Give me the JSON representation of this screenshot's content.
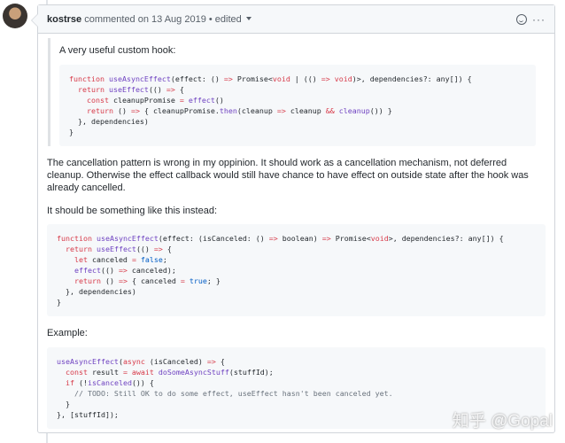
{
  "comment": {
    "author": "kostrse",
    "action": "commented on 13 Aug 2019",
    "edited": "• edited"
  },
  "quote_text": "A very useful custom hook:",
  "code1": [
    [
      [
        "k",
        "function "
      ],
      [
        "f",
        "useAsyncEffect"
      ],
      [
        "",
        "(effect: () "
      ],
      [
        "k",
        "=>"
      ],
      [
        "",
        " Promise<"
      ],
      [
        "k",
        "void"
      ],
      [
        "",
        " | (() "
      ],
      [
        "k",
        "=>"
      ],
      [
        "k",
        " void"
      ],
      [
        "",
        ")>, dependencies?: any[]) {"
      ]
    ],
    [
      [
        "k",
        "  return "
      ],
      [
        "f",
        "useEffect"
      ],
      [
        "",
        "(() "
      ],
      [
        "k",
        "=>"
      ],
      [
        "",
        " {"
      ]
    ],
    [
      [
        "k",
        "    const "
      ],
      [
        "",
        "cleanupPromise "
      ],
      [
        "k",
        "="
      ],
      [
        "f",
        " effect"
      ],
      [
        "",
        "()"
      ]
    ],
    [
      [
        "k",
        "    return "
      ],
      [
        "",
        "() "
      ],
      [
        "k",
        "=>"
      ],
      [
        "",
        " { cleanupPromise."
      ],
      [
        "f",
        "then"
      ],
      [
        "",
        "(cleanup "
      ],
      [
        "k",
        "=>"
      ],
      [
        "",
        " cleanup "
      ],
      [
        "k",
        "&&"
      ],
      [
        "f",
        " cleanup"
      ],
      [
        "",
        "()) }"
      ]
    ],
    [
      [
        "",
        "  }, dependencies)"
      ]
    ],
    [
      [
        "",
        "}"
      ]
    ]
  ],
  "para1": "The cancellation pattern is wrong in my oppinion. It should work as a cancellation mechanism, not deferred cleanup. Otherwise the effect callback would still have chance to have effect on outside state after the hook was already cancelled.",
  "para2": "It should be something like this instead:",
  "code2": [
    [
      [
        "k",
        "function "
      ],
      [
        "f",
        "useAsyncEffect"
      ],
      [
        "",
        "(effect: (isCanceled: () "
      ],
      [
        "k",
        "=>"
      ],
      [
        "",
        " boolean) "
      ],
      [
        "k",
        "=>"
      ],
      [
        "",
        " Promise<"
      ],
      [
        "k",
        "void"
      ],
      [
        "",
        ">, dependencies?: any[]) {"
      ]
    ],
    [
      [
        "k",
        "  return "
      ],
      [
        "f",
        "useEffect"
      ],
      [
        "",
        "(() "
      ],
      [
        "k",
        "=>"
      ],
      [
        "",
        " {"
      ]
    ],
    [
      [
        "k",
        "    let "
      ],
      [
        "",
        "canceled "
      ],
      [
        "k",
        "="
      ],
      [
        "c",
        " false"
      ],
      [
        "",
        ";"
      ]
    ],
    [
      [
        "f",
        "    effect"
      ],
      [
        "",
        "(() "
      ],
      [
        "k",
        "=>"
      ],
      [
        "",
        " canceled);"
      ]
    ],
    [
      [
        "k",
        "    return "
      ],
      [
        "",
        "() "
      ],
      [
        "k",
        "=>"
      ],
      [
        "",
        " { canceled "
      ],
      [
        "k",
        "="
      ],
      [
        "c",
        " true"
      ],
      [
        "",
        "; }"
      ]
    ],
    [
      [
        "",
        "  }, dependencies)"
      ]
    ],
    [
      [
        "",
        "}"
      ]
    ]
  ],
  "para3": "Example:",
  "code3": [
    [
      [
        "f",
        "useAsyncEffect"
      ],
      [
        "",
        "("
      ],
      [
        "k",
        "async"
      ],
      [
        "",
        " (isCanceled) "
      ],
      [
        "k",
        "=>"
      ],
      [
        "",
        " {"
      ]
    ],
    [
      [
        "k",
        "  const "
      ],
      [
        "",
        "result "
      ],
      [
        "k",
        "="
      ],
      [
        "k",
        " await "
      ],
      [
        "f",
        "doSomeAsyncStuff"
      ],
      [
        "",
        "(stuffId);"
      ]
    ],
    [
      [
        "k",
        "  if "
      ],
      [
        "",
        "(!"
      ],
      [
        "f",
        "isCanceled"
      ],
      [
        "",
        "()) {"
      ]
    ],
    [
      [
        "cm",
        "    // TODO: Still OK to do some effect, useEffect hasn't been canceled yet."
      ]
    ],
    [
      [
        "",
        "  }"
      ]
    ],
    [
      [
        "",
        "}, [stuffId]);"
      ]
    ]
  ],
  "watermark": "知乎 @Gopal"
}
